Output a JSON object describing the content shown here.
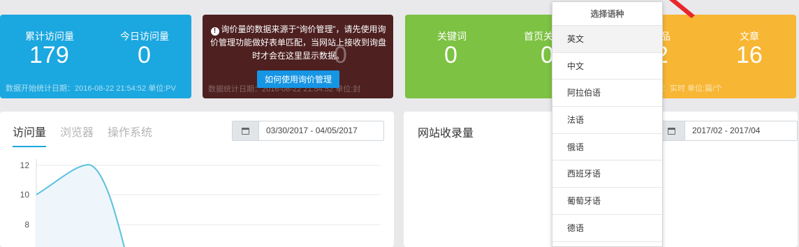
{
  "stats_visits": {
    "total_label": "累计访问量",
    "total_value": "179",
    "today_label": "今日访问量",
    "today_value": "0",
    "footnote": "数据开始统计日期：2016-08-22 21:54:52  单位:PV"
  },
  "stats_inquiry": {
    "notice": "询价量的数据来源于“询价管理”，请先使用询价管理功能做好表单匹配，当网站上接收到询盘时才会在这里显示数据。",
    "button_label": "如何使用询价管理",
    "ghost_value": "0",
    "ghost_footnote": "数据统计日期：2016-08-22 21:54:52  单位:封"
  },
  "stats_seo": {
    "keywords_label": "关键词",
    "keywords_value": "0",
    "homepage_label": "首页关",
    "homepage_value": "0"
  },
  "stats_content": {
    "products_label": "品",
    "products_value": "2",
    "articles_label": "文章",
    "articles_value": "16",
    "footnote": "：实时  单位:篇/个"
  },
  "visits_panel": {
    "tabs": [
      "访问量",
      "浏览器",
      "操作系统"
    ],
    "date_range": "03/30/2017 - 04/05/2017"
  },
  "index_panel": {
    "title": "网站收录量",
    "date_range": "2017/02 - 2017/04"
  },
  "language_dropdown": {
    "header": "选择语种",
    "items": [
      "英文",
      "中文",
      "阿拉伯语",
      "法语",
      "俄语",
      "西班牙语",
      "葡萄牙语",
      "德语"
    ]
  },
  "colors": {
    "accent": "#1ba7df",
    "card_dark": "#4e2020",
    "card_green": "#7dc243",
    "card_yellow": "#f7b633",
    "arrow": "#e8262c"
  },
  "icons": [
    "calendar-icon",
    "warning-icon",
    "arrow-pointer"
  ],
  "chart_data": {
    "type": "area",
    "y_ticks": [
      "12",
      "10",
      "8"
    ],
    "points": [
      {
        "y": 10
      },
      {
        "y": 12
      }
    ]
  }
}
